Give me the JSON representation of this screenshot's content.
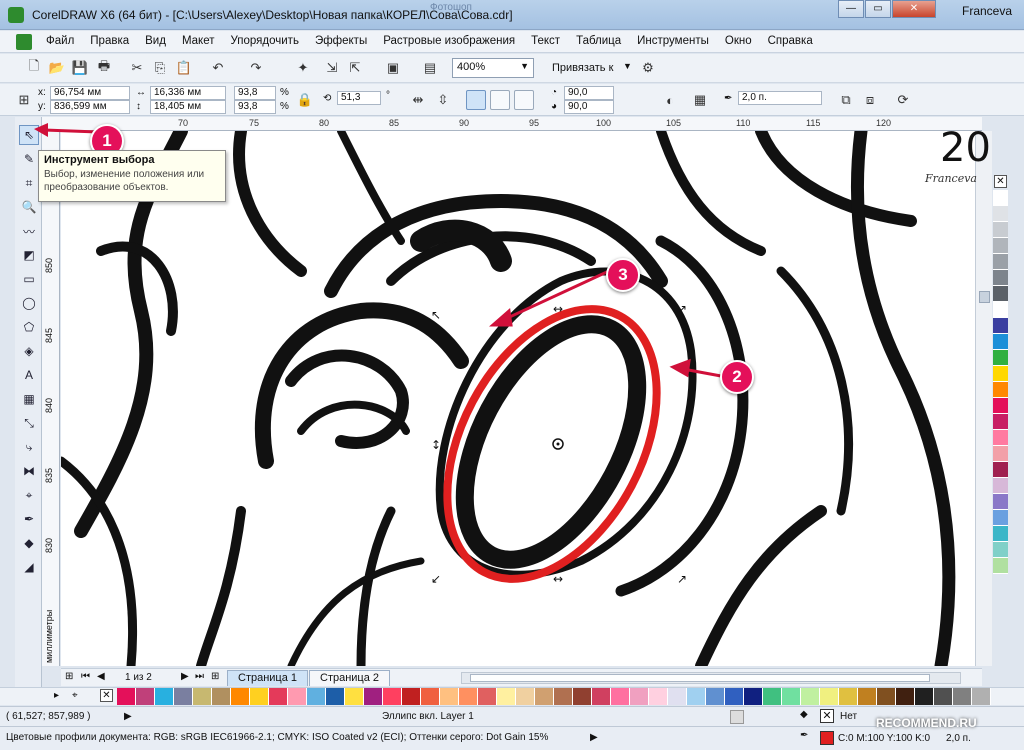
{
  "window": {
    "title": "CorelDRAW X6 (64 бит) - [C:\\Users\\Alexey\\Desktop\\Новая папка\\КОРЕЛ\\Сова\\Сова.cdr]",
    "background_tab_title": "Фотошоп"
  },
  "menu": {
    "items": [
      "Файл",
      "Правка",
      "Вид",
      "Макет",
      "Упорядочить",
      "Эффекты",
      "Растровые изображения",
      "Текст",
      "Таблица",
      "Инструменты",
      "Окно",
      "Справка"
    ]
  },
  "toolbar": {
    "zoom": "400%",
    "snap_label": "Привязать к"
  },
  "properties": {
    "x": "96,754 мм",
    "y": "836,599 мм",
    "width": "16,336 мм",
    "height": "18,405 мм",
    "scale_x": "93,8",
    "scale_y": "93,8",
    "percent": "%",
    "angle": "51,3",
    "degree": "°",
    "start_angle": "90,0",
    "end_angle": "90,0",
    "outline": "2,0 п."
  },
  "ruler": {
    "h_ticks": [
      "70",
      "75",
      "80",
      "85",
      "90",
      "95",
      "100",
      "105",
      "110",
      "115",
      "120"
    ],
    "v_ticks": [
      "850",
      "845",
      "840",
      "835",
      "830"
    ],
    "unit": "миллиметры"
  },
  "tooltip": {
    "title": "Инструмент выбора",
    "description": "Выбор, изменение положения или преобразование объектов."
  },
  "pages": {
    "counter": "1 из 2",
    "tabs": [
      "Страница 1",
      "Страница 2"
    ]
  },
  "status": {
    "coords": "( 61,527; 857,989 )",
    "object_info": "Эллипс вкл. Layer 1",
    "fill_label": "Нет",
    "color_profiles": "Цветовые профили документа: RGB: sRGB IEC61966-2.1; CMYK: ISO Coated v2 (ECI); Оттенки серого: Dot Gain 15%",
    "outline_color": "C:0 M:100 Y:100 K:0",
    "outline_width": "2,0 п."
  },
  "callouts": [
    "1",
    "2",
    "3"
  ],
  "watermark": {
    "name": "Franceva",
    "number": "20",
    "signature": "Franceva",
    "site": "RECOMMEND.RU"
  },
  "colors": {
    "accent_callout": "#e4105a",
    "ellipse_outline": "#e02020",
    "selected_tool": "#cfe3f7"
  },
  "palette_colors": [
    "#ffffff",
    "#dfe2e6",
    "#c8ccd1",
    "#b0b5bb",
    "#9aa0a7",
    "#7d848c",
    "#5b6168",
    "#ffffff",
    "#3a3ea0",
    "#1c8fd8",
    "#30b040",
    "#ffd800",
    "#ff8800",
    "#e4105a",
    "#c81e64",
    "#ff7aa0",
    "#f2a0a8",
    "#a02050",
    "#d7b8d8",
    "#8a78c8",
    "#6aa0e0",
    "#3bb6c8",
    "#80d0c8",
    "#b0e0a0"
  ],
  "bottom_palette_colors": [
    "#e4105a",
    "#c0407a",
    "#28b0e0",
    "#7a7fa0",
    "#c7b870",
    "#b09060",
    "#ff8800",
    "#ffd020",
    "#e43a5a",
    "#ff9ab0",
    "#60b0e0",
    "#1d5ea8",
    "#ffe040",
    "#a02080",
    "#ff4060",
    "#c02020",
    "#f06040",
    "#ffc080",
    "#ff9060",
    "#e06060",
    "#fff0a0",
    "#f0d0a0",
    "#d0a070",
    "#b07050",
    "#904030",
    "#d04060",
    "#ff70a0",
    "#f0a0c0",
    "#ffd0e0",
    "#e0e0f0",
    "#a0d0f0",
    "#6090d0",
    "#3060c0",
    "#102080",
    "#40c080",
    "#70e0a0",
    "#c0f0a0",
    "#f0f080",
    "#e0c040",
    "#c08020",
    "#805020",
    "#402010",
    "#202020",
    "#505050",
    "#808080",
    "#b0b0b0"
  ]
}
